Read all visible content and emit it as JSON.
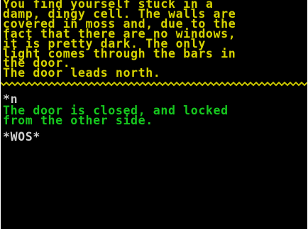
{
  "description_lines": [
    "You find yourself stuck in a",
    "damp, dingy cell. The walls are",
    "covered in moss and, due to the",
    "fact that there are no windows,",
    "it is pretty dark. The only",
    "light comes through the bars in",
    "the door.",
    "The door leads north."
  ],
  "command": "*n",
  "response_lines": [
    "The door is closed, and locked",
    "from the other side."
  ],
  "prompt": "*WOS*",
  "colors": {
    "description": "#d7d400",
    "response": "#16c81e",
    "divider": "#c8c400",
    "background": "#000000"
  }
}
